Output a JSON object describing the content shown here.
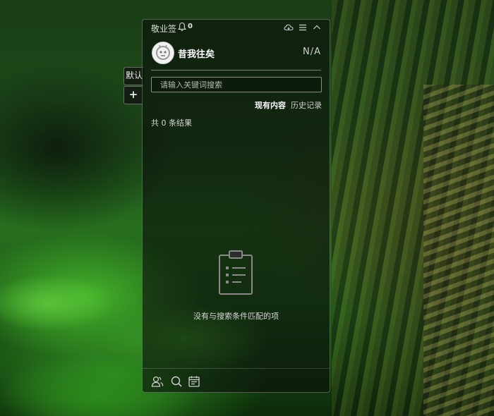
{
  "app": {
    "title": "敬业签",
    "notification_count": "0"
  },
  "side_tabs": [
    {
      "label": "默认"
    },
    {
      "label": "+"
    }
  ],
  "user": {
    "name": "昔我往矣",
    "status": "N/A"
  },
  "search": {
    "placeholder": "请输入关键词搜索",
    "value": ""
  },
  "tabs": [
    {
      "label": "现有内容",
      "active": true
    },
    {
      "label": "历史记录",
      "active": false
    }
  ],
  "results": {
    "count_text": "共 0 条结果",
    "empty_message": "没有与搜索条件匹配的项"
  },
  "icons": {
    "bell": "bell-icon",
    "cloud": "cloud-sync-icon",
    "menu": "menu-icon",
    "collapse": "chevron-up-icon",
    "empty": "clipboard-icon",
    "footer": [
      "contacts-icon",
      "search-icon",
      "calendar-icon"
    ]
  },
  "colors": {
    "panel_bg": "#0a0e0a",
    "text": "#e6e6e6",
    "accent": "#ffffff"
  }
}
